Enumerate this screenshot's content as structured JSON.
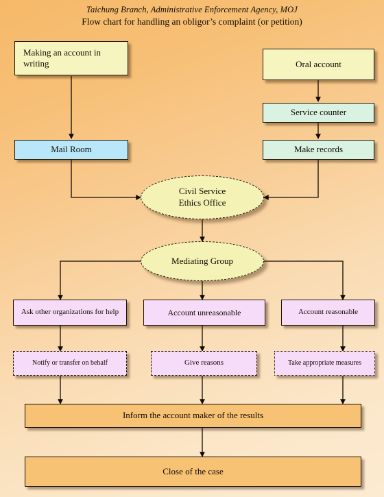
{
  "title": {
    "line1": "Taichung Branch, Administrative Enforcement Agency, MOJ",
    "line2": "Flow chart for handling an obligor’s complaint (or petition)"
  },
  "colors": {
    "background_top": "#f6b969",
    "background_bottom": "#fcebd2",
    "yellow_box": "#f7f5bf",
    "mint_box": "#d9f2e2",
    "blue_box": "#b9e7fa",
    "purple_box": "#f7dcf9",
    "orange_box": "#f8c275",
    "ellipse_fill": "#f4f2b4",
    "outline": "#1a1208"
  },
  "nodes": {
    "making_account_writing": "Making an account in writing",
    "oral_account": "Oral account",
    "service_counter": "Service counter",
    "make_records": "Make records",
    "mail_room": "Mail Room",
    "ethics_office": "Civil Service\nEthics Office",
    "ethics_office_line1": "Civil Service",
    "ethics_office_line2": "Ethics Office",
    "mediating_group": "Mediating Group",
    "ask_other_organizations": "Ask other organizations for help",
    "account_unreasonable": "Account unreasonable",
    "account_reasonable": "Account reasonable",
    "notify_or_transfer": "Notify or transfer on behalf",
    "give_reasons": "Give reasons",
    "take_appropriate_measures": "Take appropriate measures",
    "inform_account_maker": "Inform the account maker of the results",
    "close_of_case": "Close of the case"
  },
  "flow": {
    "edges": [
      {
        "from": "making_account_writing",
        "to": "mail_room"
      },
      {
        "from": "oral_account",
        "to": "service_counter"
      },
      {
        "from": "service_counter",
        "to": "make_records"
      },
      {
        "from": "mail_room",
        "to": "ethics_office"
      },
      {
        "from": "make_records",
        "to": "ethics_office"
      },
      {
        "from": "ethics_office",
        "to": "mediating_group"
      },
      {
        "from": "mediating_group",
        "to": "ask_other_organizations"
      },
      {
        "from": "mediating_group",
        "to": "account_unreasonable"
      },
      {
        "from": "mediating_group",
        "to": "account_reasonable"
      },
      {
        "from": "ask_other_organizations",
        "to": "notify_or_transfer"
      },
      {
        "from": "account_unreasonable",
        "to": "give_reasons"
      },
      {
        "from": "account_reasonable",
        "to": "take_appropriate_measures"
      },
      {
        "from": "notify_or_transfer",
        "to": "inform_account_maker"
      },
      {
        "from": "give_reasons",
        "to": "inform_account_maker"
      },
      {
        "from": "take_appropriate_measures",
        "to": "inform_account_maker"
      },
      {
        "from": "inform_account_maker",
        "to": "close_of_case"
      }
    ]
  }
}
